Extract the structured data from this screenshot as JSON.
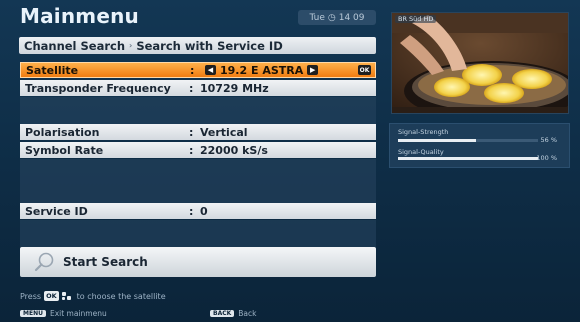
{
  "header": {
    "title": "Mainmenu",
    "clock_day": "Tue",
    "clock_time": "14 09"
  },
  "breadcrumb": {
    "parent": "Channel Search",
    "current": "Search with Service ID"
  },
  "rows": {
    "satellite": {
      "label": "Satellite",
      "value": "19.2 E ASTRA"
    },
    "transponder": {
      "label": "Transponder Frequency",
      "value": "10729 MHz"
    },
    "polarisation": {
      "label": "Polarisation",
      "value": "Vertical"
    },
    "symbol_rate": {
      "label": "Symbol Rate",
      "value": "22000 kS/s"
    },
    "service_id": {
      "label": "Service ID",
      "value": "0"
    }
  },
  "colon": ":",
  "ok_key": "OK",
  "start_search": {
    "label": "Start Search"
  },
  "footer": {
    "press": "Press",
    "ok_badge": "OK",
    "hint_suffix": "to choose the satellite",
    "menu_badge": "MENU",
    "exit_label": "Exit mainmenu",
    "back_badge": "BACK",
    "back_label": "Back"
  },
  "preview": {
    "channel": "BR Süd HD"
  },
  "signal": {
    "strength_label": "Signal-Strength",
    "strength_pct": "56 %",
    "strength_value": 56,
    "quality_label": "Signal-Quality",
    "quality_pct": "100 %",
    "quality_value": 100
  },
  "colors": {
    "accent": "#f07d12",
    "background": "#0f2f49"
  }
}
